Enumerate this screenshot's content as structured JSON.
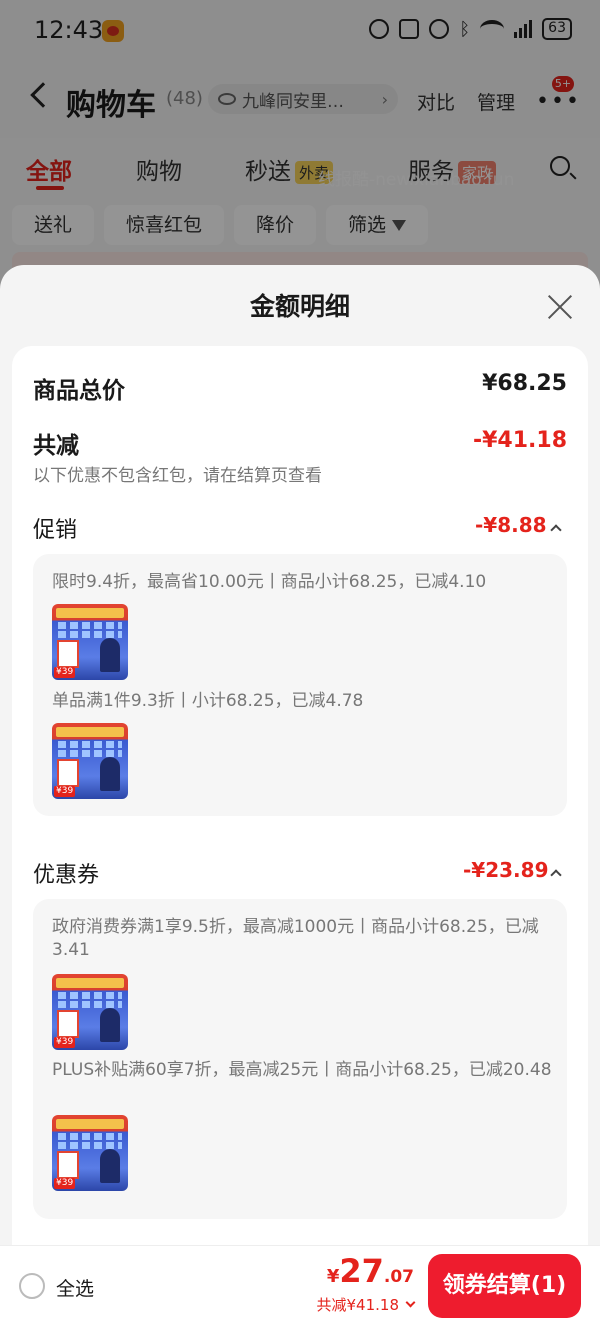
{
  "status_bar": {
    "time": "12:43",
    "battery": "63"
  },
  "header": {
    "title": "购物车",
    "count": "(48)",
    "address": "九峰同安里…",
    "compare": "对比",
    "manage": "管理",
    "msg_badge": "5+"
  },
  "tabs": [
    {
      "label": "全部",
      "badge": ""
    },
    {
      "label": "购物",
      "badge": ""
    },
    {
      "label": "秒送",
      "badge": "外卖"
    },
    {
      "label": "服务",
      "badge": "家政"
    }
  ],
  "watermark": "线报酷-new.xianbao.fun",
  "chips": [
    "送礼",
    "惊喜红包",
    "降价",
    "筛选"
  ],
  "sheet": {
    "title": "金额明细",
    "total_label": "商品总价",
    "total_value": "¥68.25",
    "discount_label": "共减",
    "discount_value": "-¥41.18",
    "discount_hint": "以下优惠不包含红包，请在结算页查看",
    "promo": {
      "label": "促销",
      "value": "-¥8.88",
      "items": [
        "限时9.4折，最高省10.00元丨商品小计68.25，已减4.10",
        "单品满1件9.3折丨小计68.25，已减4.78"
      ]
    },
    "coupon": {
      "label": "优惠券",
      "value": "-¥23.89",
      "items": [
        "政府消费券满1享9.5折，最高减1000元丨商品小计68.25，已减3.41",
        "PLUS补贴满60享7折，最高减25元丨商品小计68.25，已减20.48"
      ]
    },
    "thumb_price": "¥39"
  },
  "bottom_bar": {
    "select_all": "全选",
    "currency": "¥",
    "total_int": "27",
    "total_dec": ".07",
    "saved": "共减¥41.18",
    "checkout": "领券结算(1)"
  },
  "colors": {
    "accent_red": "#e4231c",
    "checkout_red": "#ee1c2e"
  }
}
